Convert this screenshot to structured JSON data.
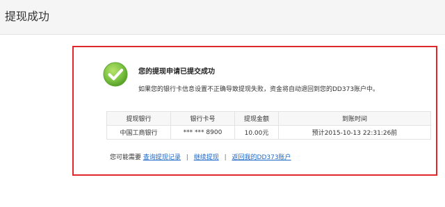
{
  "header": {
    "title": "提现成功"
  },
  "success": {
    "title": "您的提现申请已提交成功",
    "description": "如果您的银行卡信息设置不正确导致提现失败，资金将自动退回到您的DD373账户中。",
    "icon": "check-circle-icon",
    "icon_color": "#7cc242"
  },
  "table": {
    "headers": [
      "提现银行",
      "银行卡号",
      "提现金额",
      "到账时间"
    ],
    "rows": [
      [
        "中国工商银行",
        "*** *** 8900",
        "10.00元",
        "预计2015-10-13 22:31:26前"
      ]
    ]
  },
  "links": {
    "prefix": "您可能需要",
    "items": [
      "查询提现记录",
      "继续提现",
      "返回我的DD373账户"
    ],
    "separator": "|",
    "link_color": "#1a66c9"
  },
  "colors": {
    "panel_border": "#e0262b"
  }
}
